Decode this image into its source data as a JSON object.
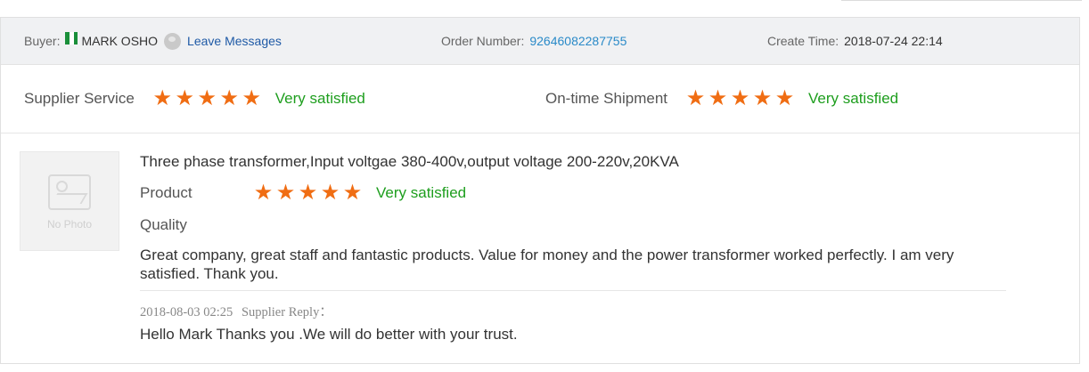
{
  "header": {
    "buyer_label": "Buyer:",
    "buyer_name": "MARK OSHO",
    "buyer_flag": "nigeria-flag-icon",
    "leave_messages": "Leave Messages",
    "order_label": "Order Number:",
    "order_number": "92646082287755",
    "create_label": "Create Time:",
    "create_time": "2018-07-24 22:14"
  },
  "ratings": {
    "supplier_service": {
      "label": "Supplier Service",
      "stars": 5,
      "text": "Very satisfied"
    },
    "ontime_shipment": {
      "label": "On-time Shipment",
      "stars": 5,
      "text": "Very satisfied"
    }
  },
  "review": {
    "photo_placeholder": "No Photo",
    "product_title": "Three phase transformer,Input voltgae 380-400v,output voltage 200-220v,20KVA",
    "product_label": "Product",
    "product_stars": 5,
    "product_text": "Very satisfied",
    "quality_label": "Quality",
    "comment": "Great company, great staff and fantastic products. Value for money and the power transformer worked perfectly. I am very satisfied. Thank you.",
    "reply_time": "2018-08-03 02:25",
    "reply_label": "Supplier Reply：",
    "reply_text": "Hello Mark Thanks you .We will do better with your trust."
  },
  "colors": {
    "star": "#f06d13",
    "satisfied": "#1e9e1e",
    "link": "#1f5aa6",
    "order_number": "#2a8ac8",
    "header_bg": "#f0f1f3"
  }
}
